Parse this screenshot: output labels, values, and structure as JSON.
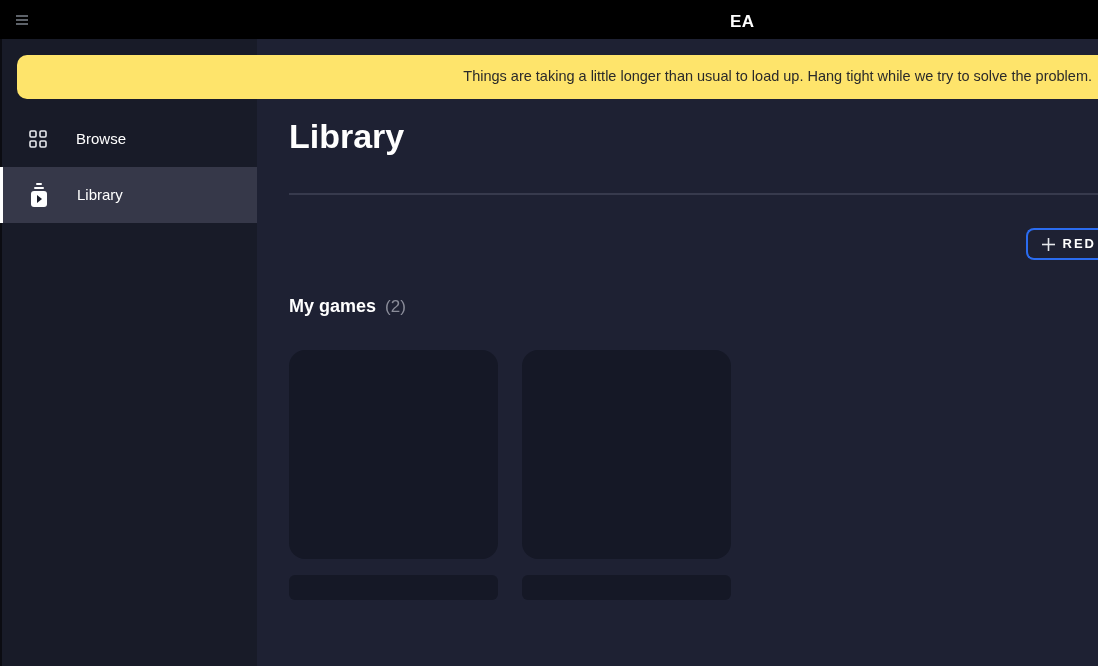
{
  "top_bar": {
    "logo": "EA"
  },
  "banner": {
    "message": "Things are taking a little longer than usual to load up. Hang tight while we try to solve the problem."
  },
  "sidebar": {
    "items": [
      {
        "label": "Browse",
        "kind": "grid",
        "selected": false
      },
      {
        "label": "Library",
        "kind": "library",
        "selected": true
      }
    ]
  },
  "page": {
    "title": "Library",
    "redeem_button": "RED",
    "section": {
      "title": "My games",
      "count": "(2)",
      "games": [
        {
          "kind": "placeholder"
        },
        {
          "kind": "placeholder"
        }
      ]
    }
  }
}
